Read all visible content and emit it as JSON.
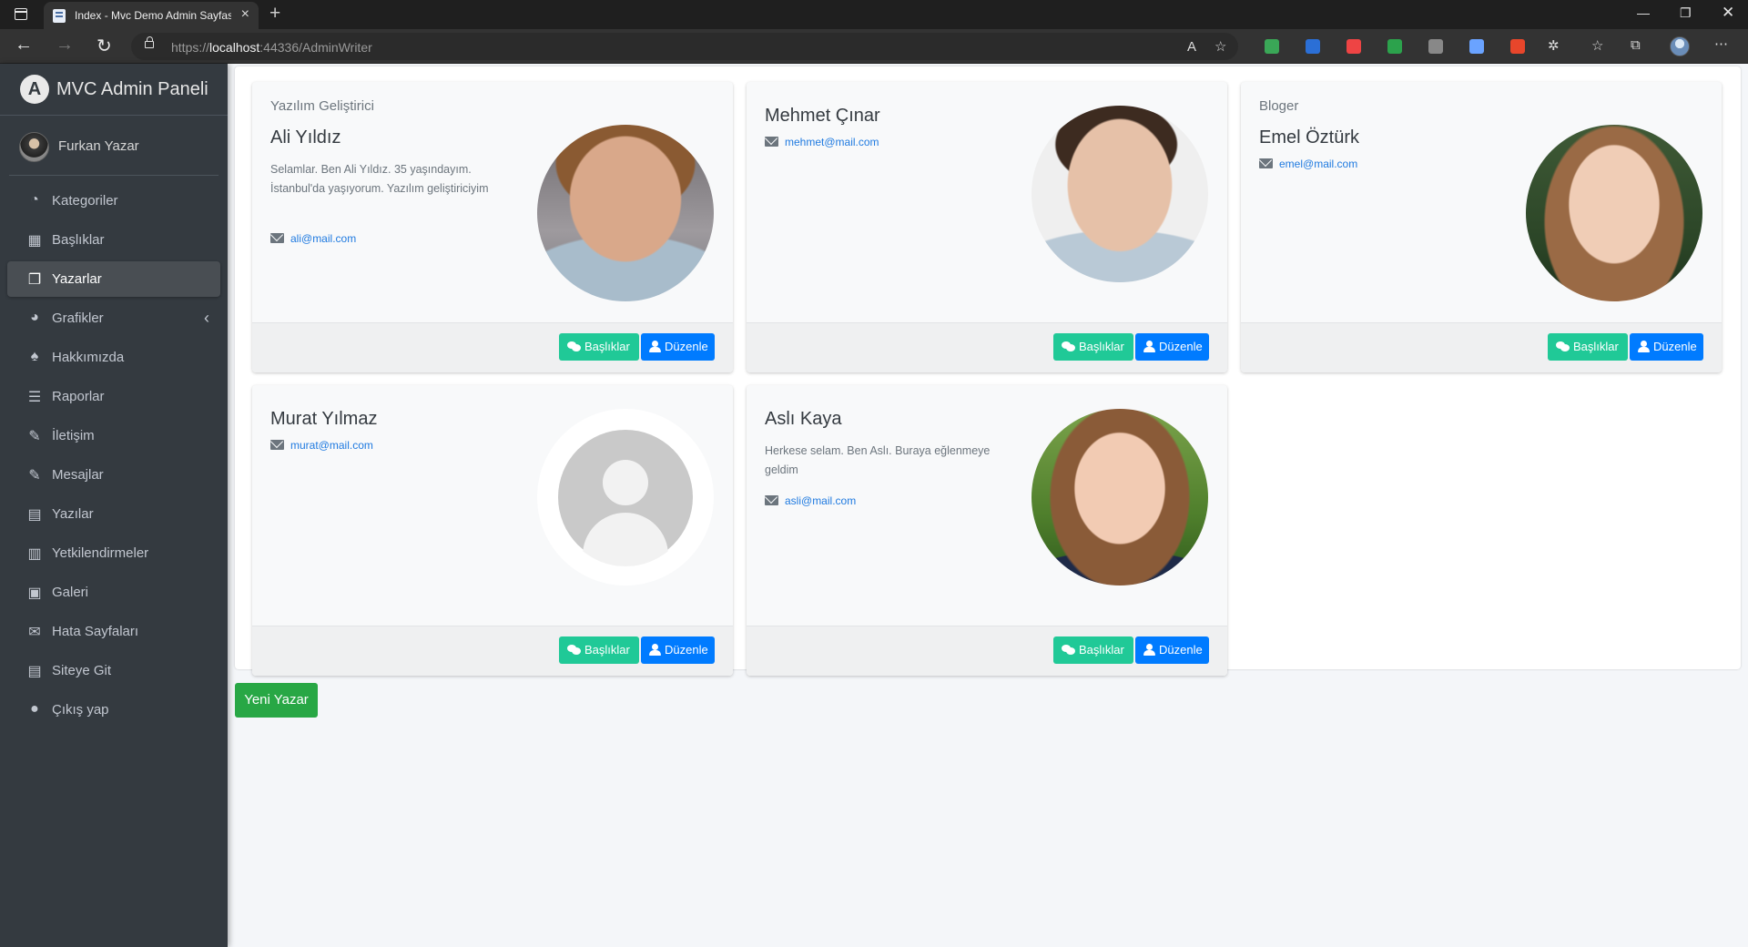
{
  "browser": {
    "tab_title": "Index - Mvc Demo Admin Sayfası",
    "url_prefix": "https://",
    "url_host": "localhost",
    "url_path": ":44336/AdminWriter",
    "extension_colors": [
      "#3aa757",
      "#2b6fd6",
      "#e44",
      "#2ca24c",
      "#888",
      "#6aa3ff",
      "#e8462b"
    ]
  },
  "sidebar": {
    "brand": "MVC Admin Paneli",
    "brand_letter": "A",
    "user_name": "Furkan Yazar",
    "items": [
      {
        "label": "Kategoriler",
        "icon": "dashboard-icon",
        "glyph": "◔"
      },
      {
        "label": "Başlıklar",
        "icon": "grid-icon",
        "glyph": "▦"
      },
      {
        "label": "Yazarlar",
        "icon": "copy-icon",
        "glyph": "❐"
      },
      {
        "label": "Grafikler",
        "icon": "pie-chart-icon",
        "glyph": "◕"
      },
      {
        "label": "Hakkımızda",
        "icon": "tree-icon",
        "glyph": "♠"
      },
      {
        "label": "Raporlar",
        "icon": "list-icon",
        "glyph": "☰"
      },
      {
        "label": "İletişim",
        "icon": "edit-icon",
        "glyph": "✎"
      },
      {
        "label": "Mesajlar",
        "icon": "edit-icon",
        "glyph": "✎"
      },
      {
        "label": "Yazılar",
        "icon": "table-icon",
        "glyph": "▤"
      },
      {
        "label": "Yetkilendirmeler",
        "icon": "calendar-icon",
        "glyph": "▥"
      },
      {
        "label": "Galeri",
        "icon": "image-icon",
        "glyph": "▣"
      },
      {
        "label": "Hata Sayfaları",
        "icon": "envelope-icon",
        "glyph": "✉"
      },
      {
        "label": "Siteye Git",
        "icon": "file-icon",
        "glyph": "▤"
      },
      {
        "label": "Çıkış yap",
        "icon": "apple-icon",
        "glyph": "●"
      }
    ],
    "active_index": 2,
    "expand_arrow": "‹"
  },
  "writers": [
    {
      "title": "Yazılım Geliştirici",
      "name": "Ali Yıldız",
      "about": "Selamlar. Ben Ali Yıldız. 35 yaşındayım. İstanbul'da yaşıyorum. Yazılım geliştiriciyim",
      "email": "ali@mail.com",
      "photo": "ph-ali"
    },
    {
      "title": "",
      "name": "Mehmet Çınar",
      "about": "",
      "email": "mehmet@mail.com",
      "photo": "ph-mehmet"
    },
    {
      "title": "Bloger",
      "name": "Emel Öztürk",
      "about": "",
      "email": "emel@mail.com",
      "photo": "ph-emel"
    },
    {
      "title": "",
      "name": "Murat Yılmaz",
      "about": "",
      "email": "murat@mail.com",
      "photo": "ph-default"
    },
    {
      "title": "",
      "name": "Aslı Kaya",
      "about": "Herkese selam. Ben Aslı. Buraya eğlenmeye geldim",
      "email": "asli@mail.com",
      "photo": "ph-asli"
    }
  ],
  "buttons": {
    "headings": "Başlıklar",
    "edit": "Düzenle",
    "new_writer": "Yeni Yazar"
  }
}
